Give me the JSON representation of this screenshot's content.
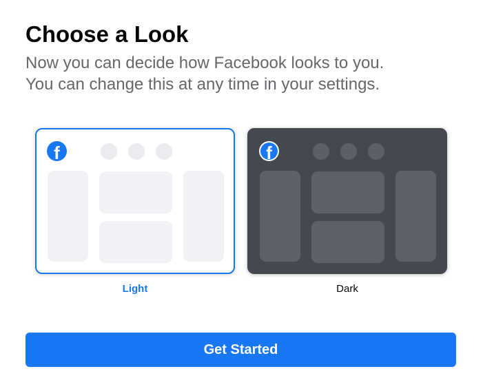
{
  "header": {
    "title": "Choose a Look",
    "subtitle_line1": "Now you can decide how Facebook looks to you.",
    "subtitle_line2": "You can change this at any time in your settings."
  },
  "options": [
    {
      "label": "Light",
      "selected": true,
      "logo_icon": "facebook-logo-icon"
    },
    {
      "label": "Dark",
      "selected": false,
      "logo_icon": "facebook-logo-icon"
    }
  ],
  "cta": {
    "label": "Get Started"
  },
  "colors": {
    "accent": "#1877f2",
    "dark_card": "#45484e",
    "light_placeholder": "#f0f2f5",
    "dark_placeholder": "#5c6068"
  }
}
